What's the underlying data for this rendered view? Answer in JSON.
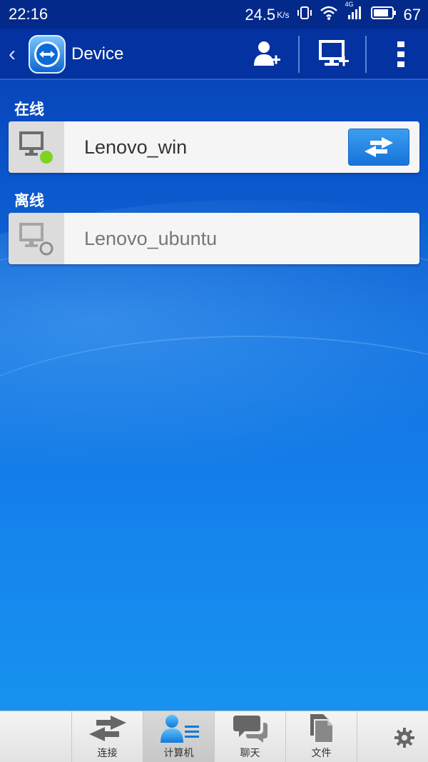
{
  "status_bar": {
    "time": "22:16",
    "speed": "24.5",
    "speed_unit": "K/s",
    "network": "4G",
    "battery": "67"
  },
  "header": {
    "title": "Device",
    "icons": [
      "back-icon",
      "teamviewer-logo",
      "add-contact-icon",
      "add-computer-icon",
      "overflow-menu-icon"
    ]
  },
  "online": {
    "label": "在线",
    "device": {
      "name": "Lenovo_win",
      "status": "online"
    }
  },
  "offline": {
    "label": "离线",
    "device": {
      "name": "Lenovo_ubuntu",
      "status": "offline"
    }
  },
  "bottom_nav": {
    "items": [
      {
        "label": "连接",
        "icon": "connect-icon"
      },
      {
        "label": "计算机",
        "icon": "computers-icon",
        "active": true
      },
      {
        "label": "聊天",
        "icon": "chat-icon"
      },
      {
        "label": "文件",
        "icon": "files-icon"
      }
    ],
    "settings_icon": "gear-icon"
  },
  "colors": {
    "header_bg": "#0432a0",
    "online_dot": "#7ed321",
    "connect_button": "#1f86e0"
  }
}
